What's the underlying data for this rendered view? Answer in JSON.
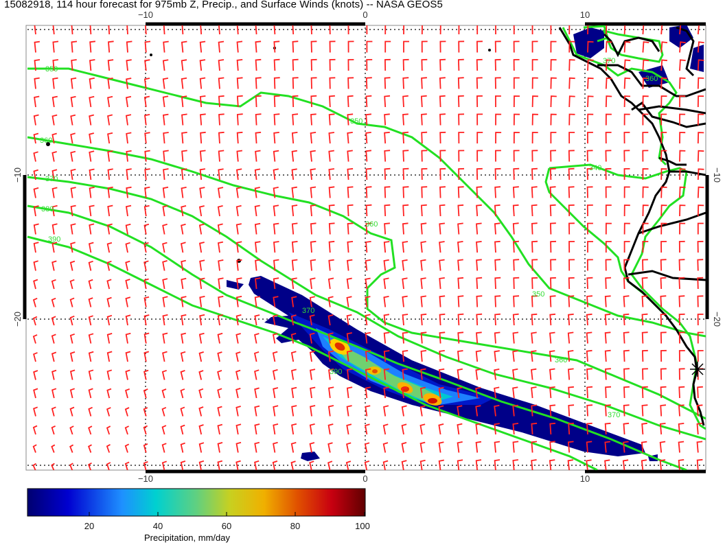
{
  "title": "15082918, 114 hour forecast for 975mb Z, Precip., and Surface Winds (knots) -- NASA GEOS5",
  "axes": {
    "top_ticks": [
      "−10",
      "0",
      "10"
    ],
    "bottom_ticks": [
      "−10",
      "0",
      "10"
    ],
    "left_ticks": [
      "−10",
      "−20"
    ],
    "right_ticks": [
      "−10",
      "−20"
    ]
  },
  "contour_labels": [
    "350",
    "360",
    "370",
    "380",
    "390",
    "350",
    "360",
    "340",
    "350",
    "360",
    "370",
    "370",
    "390",
    "370",
    "360"
  ],
  "colorbar": {
    "label": "Precipitation, mm/day",
    "ticks": [
      "20",
      "40",
      "60",
      "80",
      "100"
    ],
    "colors": [
      "#000080",
      "#0000cd",
      "#1e90ff",
      "#00ced1",
      "#40e0d0",
      "#9acd32",
      "#ffd700",
      "#ff8c00",
      "#dc143c",
      "#8b0000"
    ]
  },
  "colors": {
    "contours": "#22e022",
    "wind_barbs": "#ff2020",
    "coastline": "#000000",
    "precip_low": "#000080",
    "precip_high": "#8b0000"
  }
}
